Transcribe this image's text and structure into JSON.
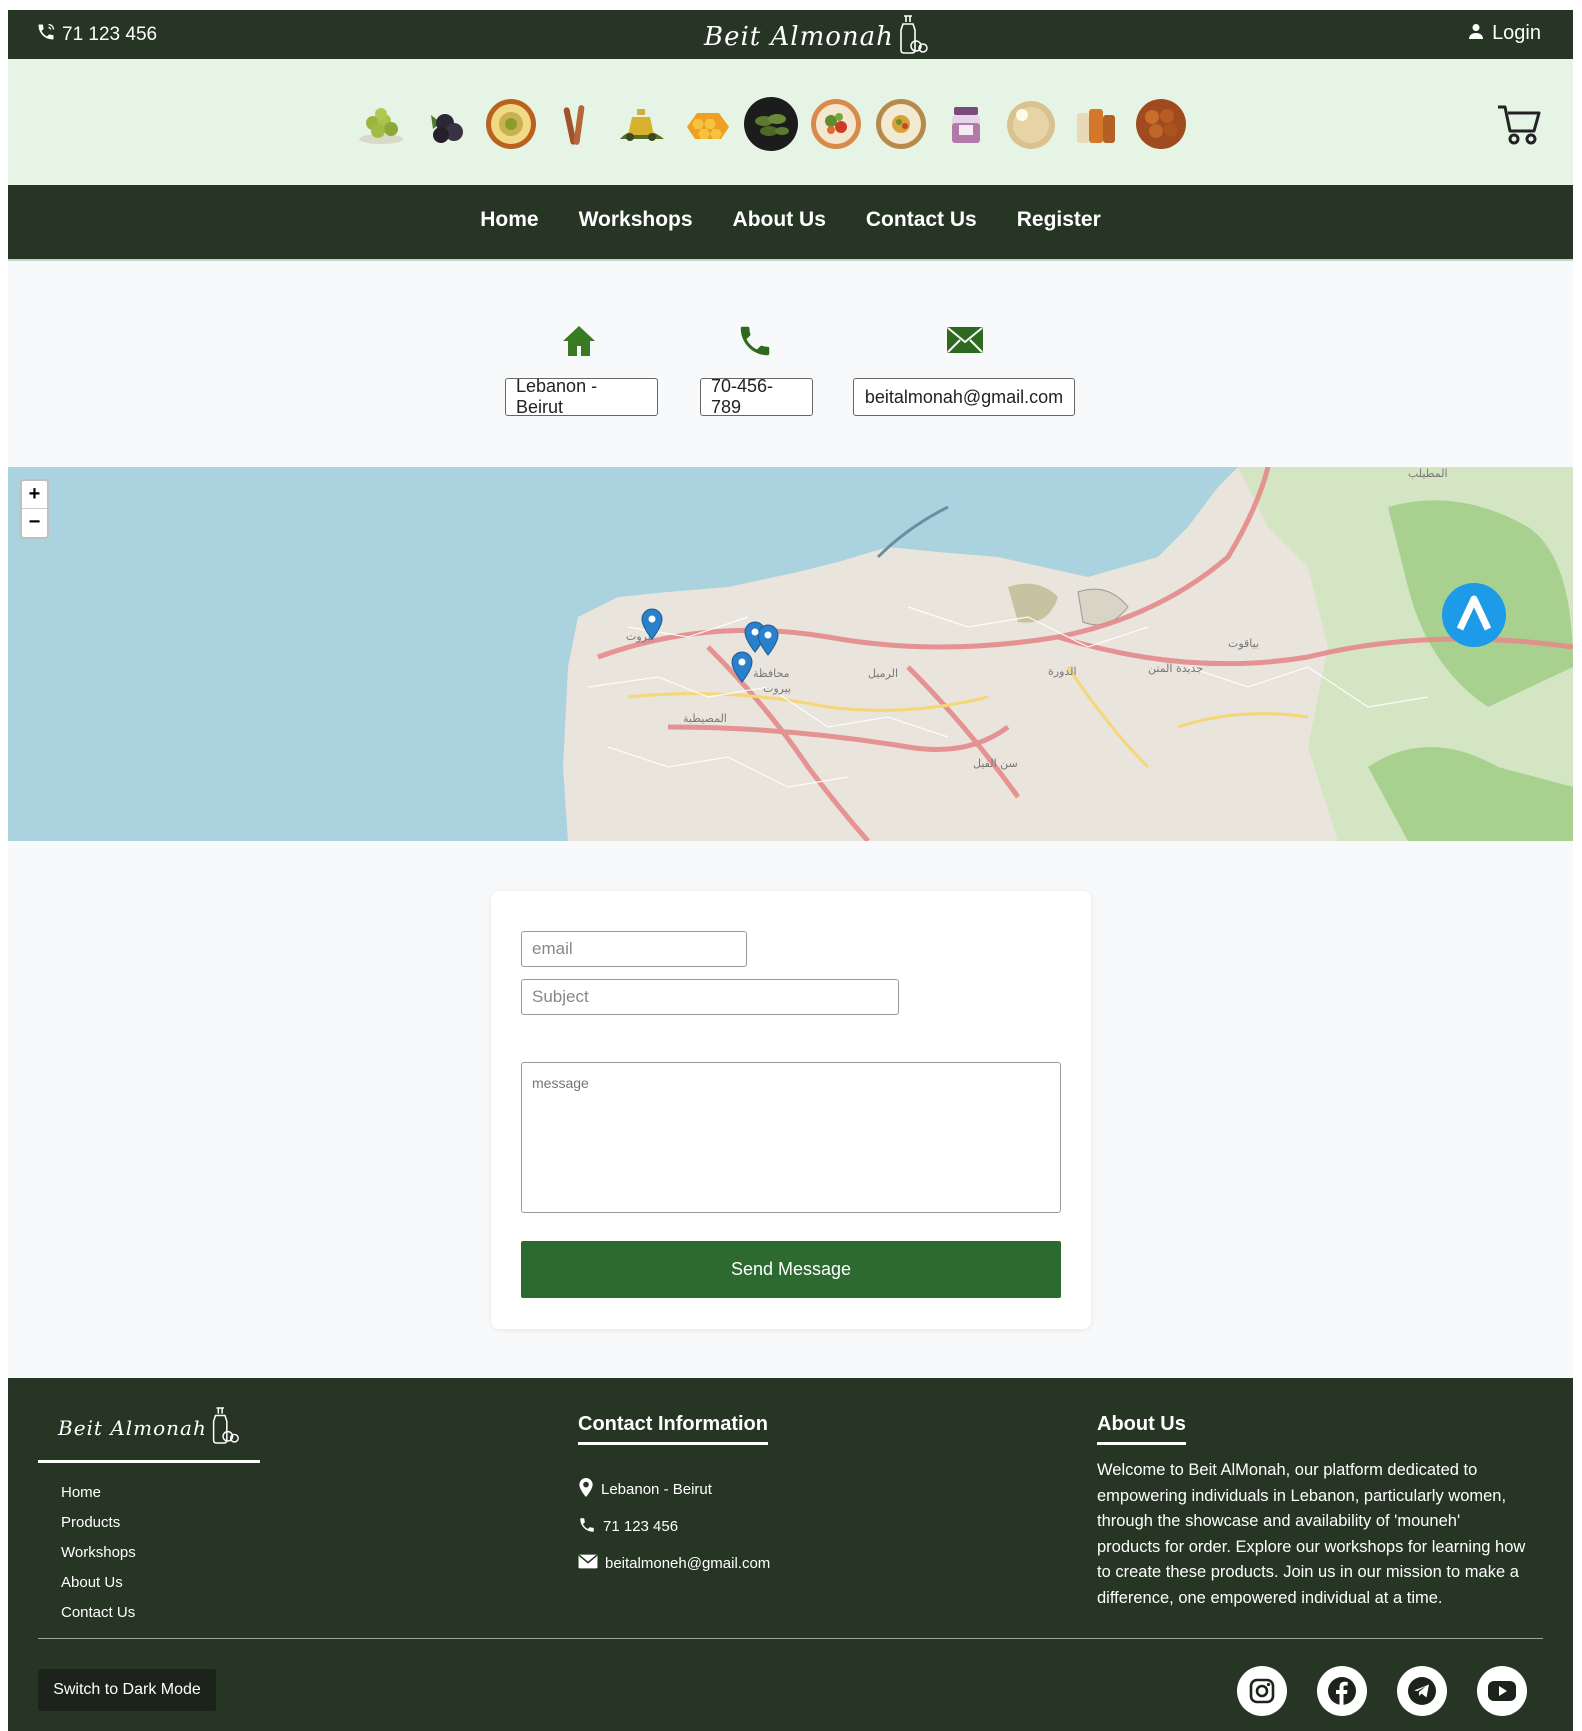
{
  "header": {
    "phone": "71 123 456",
    "brand": "Beit Almonah",
    "login_label": "Login"
  },
  "product_icons": [
    "grapes-icon",
    "berries-icon",
    "hummus-bowl-icon",
    "cinnamon-icon",
    "olive-oil-icon",
    "honeycomb-icon",
    "stuffed-vine-leaves-icon",
    "tabbouleh-icon",
    "salad-plate-icon",
    "jam-jar-icon",
    "bread-icon",
    "pasta-icon",
    "falafel-icon"
  ],
  "nav": {
    "items": [
      "Home",
      "Workshops",
      "About Us",
      "Contact Us",
      "Register"
    ]
  },
  "contact_info": {
    "address": "Lebanon - Beirut",
    "phone": "70-456-789",
    "email": "beitalmonah@gmail.com"
  },
  "map": {
    "zoom_in": "+",
    "zoom_out": "−"
  },
  "form": {
    "email_placeholder": "email",
    "subject_placeholder": "Subject",
    "message_placeholder": "message",
    "send_label": "Send Message"
  },
  "footer": {
    "brand": "Beit Almonah",
    "links": [
      "Home",
      "Products",
      "Workshops",
      "About Us",
      "Contact Us"
    ],
    "contact_heading": "Contact Information",
    "contact_address": "Lebanon - Beirut",
    "contact_phone": "71 123 456",
    "contact_email": "beitalmoneh@gmail.com",
    "about_heading": "About Us",
    "about_text": "Welcome to Beit AlMonah, our platform dedicated to empowering individuals in Lebanon, particularly women, through the showcase and availability of 'mouneh' products for order. Explore our workshops for learning how to create these products. Join us in our mission to make a difference, one empowered individual at a time.",
    "dark_mode_label": "Switch to Dark Mode",
    "socials": [
      "instagram-icon",
      "facebook-icon",
      "telegram-icon",
      "youtube-icon"
    ]
  },
  "colors": {
    "header_green": "#263524",
    "accent_green": "#2d6a2f",
    "product_bar": "#e6f4e5",
    "map_water": "#aad3df"
  }
}
